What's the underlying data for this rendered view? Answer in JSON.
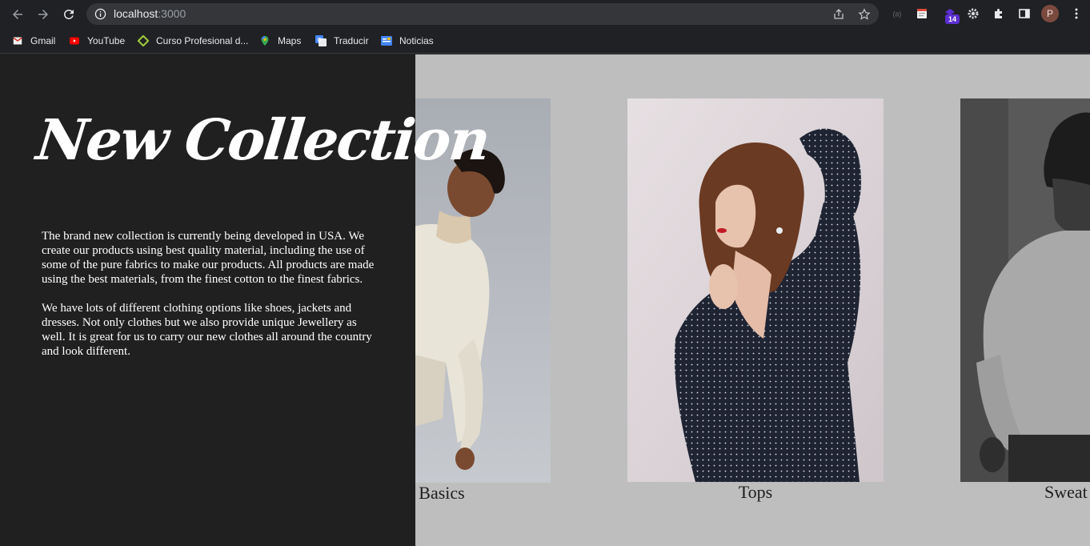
{
  "browser": {
    "url_host": "localhost",
    "url_port": ":3000",
    "profile_initial": "P",
    "extension_badge": "14"
  },
  "bookmarks": [
    {
      "label": "Gmail",
      "icon": "gmail-icon"
    },
    {
      "label": "YouTube",
      "icon": "youtube-icon"
    },
    {
      "label": "Curso Profesional d...",
      "icon": "course-icon"
    },
    {
      "label": "Maps",
      "icon": "maps-icon"
    },
    {
      "label": "Traducir",
      "icon": "translate-icon"
    },
    {
      "label": "Noticias",
      "icon": "news-icon"
    }
  ],
  "hero": {
    "title": "New Collection",
    "paragraph_1": "The brand new collection is currently being developed in USA. We create our products using best quality material, including the use of some of the pure fabrics to make our products. All products are made using the best materials, from the finest cotton to the finest fabrics.",
    "paragraph_2": "We have lots of different clothing options like shoes, jackets and dresses. Not only clothes but we also provide unique Jewellery as well. It is great for us to carry our new clothes all around the country and look different."
  },
  "cards": [
    {
      "caption": "Basics"
    },
    {
      "caption": "Tops"
    },
    {
      "caption": "Sweat"
    }
  ],
  "colors": {
    "hero_bg": "#202020",
    "page_bg": "#bebebe",
    "chrome_bg": "#202124"
  }
}
